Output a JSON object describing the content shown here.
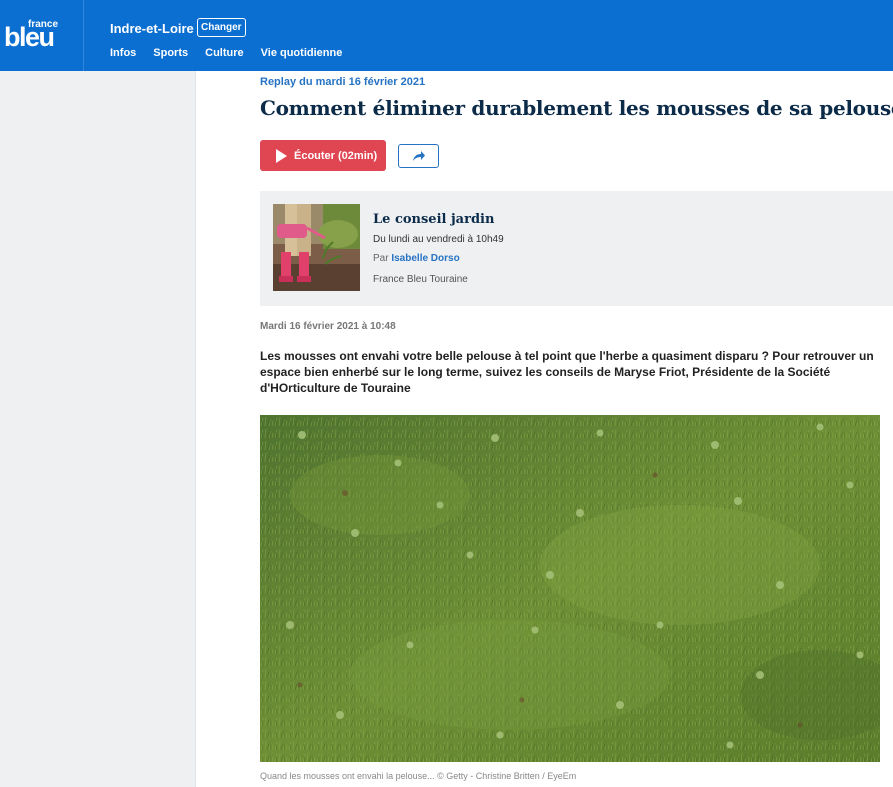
{
  "header": {
    "logo_small": "france",
    "logo_big": "bleu",
    "region": "Indre-et-Loire",
    "change_label": "Changer",
    "nav": [
      "Infos",
      "Sports",
      "Culture",
      "Vie quotidienne"
    ]
  },
  "article": {
    "replay": "Replay du mardi 16 février 2021",
    "title": "Comment éliminer durablement les mousses de sa pelouse ?",
    "listen_label": "Écouter (02min)",
    "date": "Mardi 16 février 2021 à 10:48",
    "chapo": "Les mousses ont envahi votre belle pelouse à tel point que l'herbe a quasiment disparu ? Pour retrouver un espace bien enherbé sur le long terme, suivez les conseils de Maryse Friot, Présidente de la Société d'HOrticulture de Touraine",
    "caption": "Quand les mousses ont envahi la pelouse... © Getty - Christine Britten / EyeEm"
  },
  "show": {
    "name": "Le conseil jardin",
    "schedule": "Du lundi au vendredi à 10h49",
    "by_prefix": "Par ",
    "author": "Isabelle Dorso",
    "station": "France Bleu Touraine"
  },
  "colors": {
    "brand_blue": "#0a6fd1",
    "listen_red": "#e04552",
    "title_navy": "#0b2b49",
    "link_blue": "#2673c4"
  }
}
